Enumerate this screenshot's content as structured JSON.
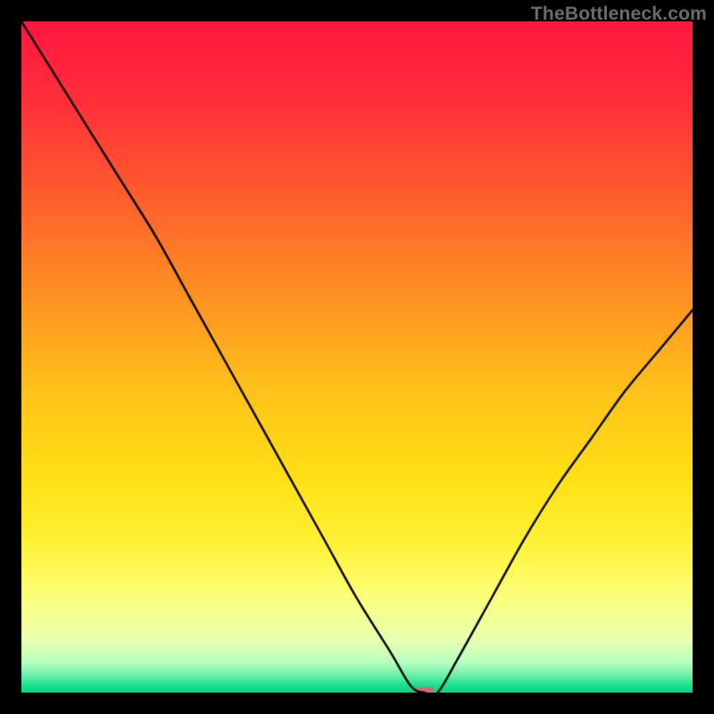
{
  "watermark": "TheBottleneck.com",
  "chart_data": {
    "type": "line",
    "title": "",
    "xlabel": "",
    "ylabel": "",
    "xlim": [
      0,
      100
    ],
    "ylim": [
      0,
      100
    ],
    "grid": false,
    "legend": false,
    "x": [
      0,
      5,
      10,
      15,
      20,
      25,
      30,
      35,
      40,
      45,
      50,
      55,
      58,
      60,
      62,
      65,
      70,
      75,
      80,
      85,
      90,
      95,
      100
    ],
    "y_bottle": [
      100,
      92,
      84,
      76,
      68,
      59,
      50,
      41,
      32,
      23,
      14,
      6,
      1,
      0,
      0,
      5,
      14,
      23,
      31,
      38,
      45,
      51,
      57
    ],
    "optimum_marker": {
      "x": 60,
      "y": 0,
      "width_pct": 3,
      "height_pct": 1.1,
      "color": "#cf6d6d"
    },
    "gradient_stops": [
      {
        "pos": 0.0,
        "color": "#ff173f"
      },
      {
        "pos": 0.12,
        "color": "#ff2f3a"
      },
      {
        "pos": 0.25,
        "color": "#ff5a2e"
      },
      {
        "pos": 0.4,
        "color": "#ff8f23"
      },
      {
        "pos": 0.55,
        "color": "#ffc21a"
      },
      {
        "pos": 0.68,
        "color": "#ffe015"
      },
      {
        "pos": 0.78,
        "color": "#fff238"
      },
      {
        "pos": 0.86,
        "color": "#fcff7e"
      },
      {
        "pos": 0.92,
        "color": "#e9ffb0"
      },
      {
        "pos": 0.955,
        "color": "#b8ffc0"
      },
      {
        "pos": 0.975,
        "color": "#66f0a8"
      },
      {
        "pos": 0.99,
        "color": "#17e08e"
      },
      {
        "pos": 1.0,
        "color": "#05d684"
      }
    ],
    "curve_color": "#000000",
    "curve_width": 2.4
  }
}
